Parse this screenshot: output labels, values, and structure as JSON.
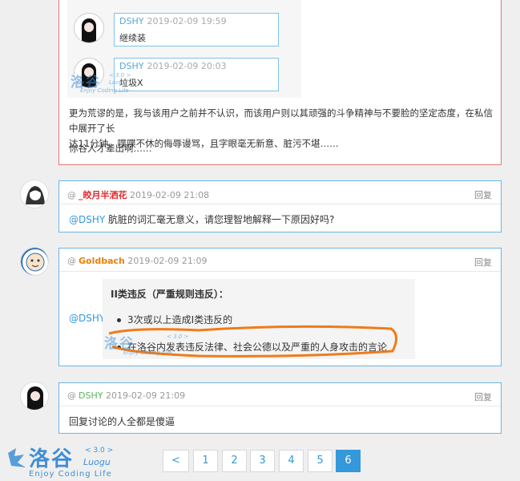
{
  "post_top": {
    "embedded": [
      {
        "user": "DSHY",
        "time": "2019-02-09 19:59",
        "text": "继续装"
      },
      {
        "user": "DSHY",
        "time": "2019-02-09 20:03",
        "text": "垃圾X"
      }
    ],
    "paragraph1_line1": "更为荒谬的是，我与该用户之前并不认识，而该用户则以其顽强的斗争精神与不要脸的坚定态度，在私信中展开了长",
    "paragraph1_line2": "达11分钟、喋喋不休的侮辱谩骂，且字眼毫无新意、脏污不堪……",
    "paragraph2": "你谷人才辈出啊……"
  },
  "comments": [
    {
      "at": "@",
      "user": "_皎月半洒花",
      "time": "2019-02-09 21:08",
      "reply": "回复",
      "mention": "@DSHY",
      "text": " 肮脏的词汇毫无意义，请您理智地解释一下原因好吗?"
    },
    {
      "at": "@",
      "user": "Goldbach",
      "time": "2019-02-09 21:09",
      "reply": "回复",
      "mention": "@DSHY"
    },
    {
      "at": "@",
      "user": "DSHY",
      "time": "2019-02-09 21:09",
      "reply": "回复",
      "text": "回复讨论的人全都是傻逼"
    }
  ],
  "rule_image": {
    "title": "II类违反（严重规则违反）：",
    "item1": "3次或以上造成I类违反的",
    "item2": "在洛谷内发表违反法律、社会公德以及严重的人身攻击的言论"
  },
  "pagination": [
    "<",
    "1",
    "2",
    "3",
    "4",
    "5",
    "6"
  ],
  "pagination_active": "6",
  "watermark": {
    "name": "洛谷",
    "version": "< 3.0 >",
    "latin": "Luogu",
    "slogan": "Enjoy Coding Life"
  },
  "colors": {
    "accent": "#3498db",
    "border_red": "#e7757a",
    "border_blue": "#6cb4e4",
    "user_red": "#e1272b",
    "user_orange": "#e6820e",
    "user_green": "#5db35d"
  }
}
